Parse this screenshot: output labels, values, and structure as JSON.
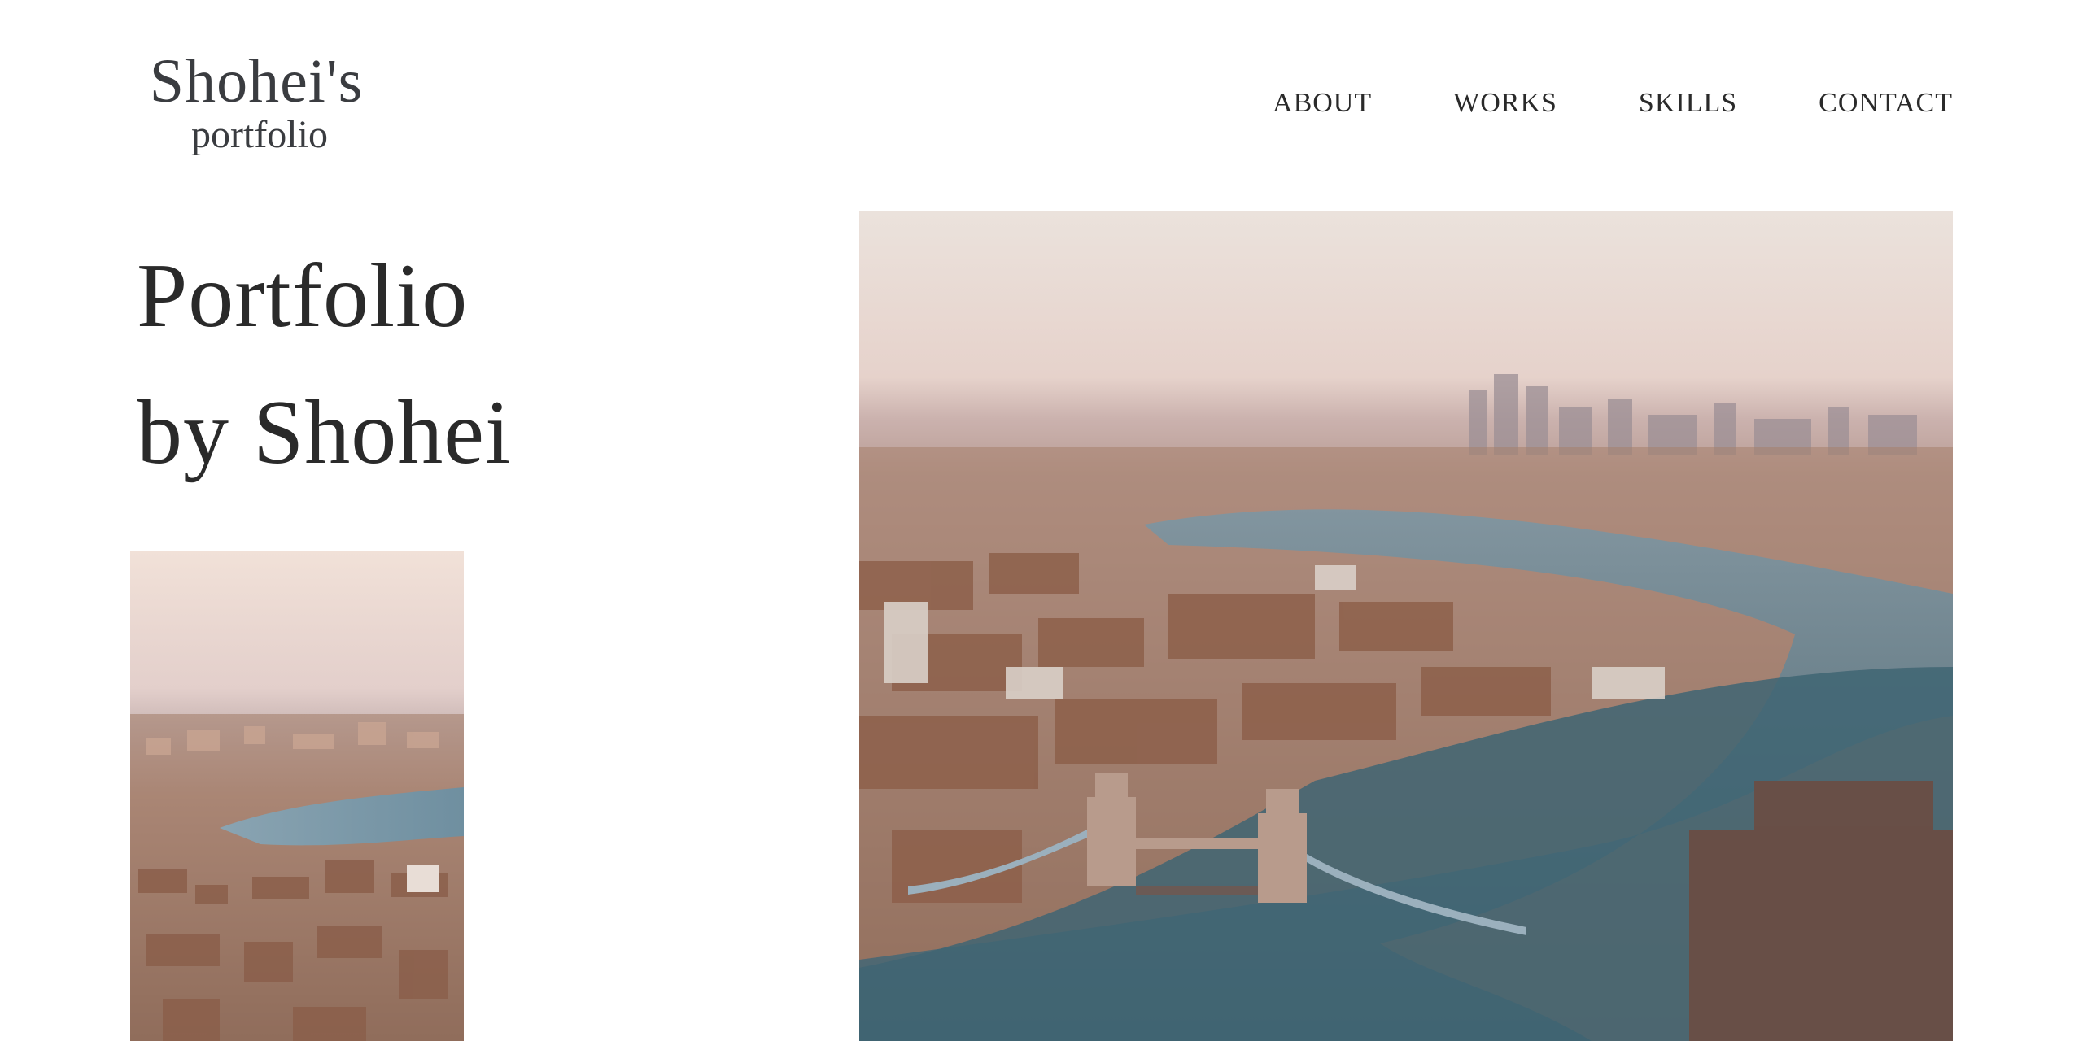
{
  "logo": {
    "main": "Shohei's",
    "sub": "portfolio"
  },
  "nav": {
    "items": [
      "ABOUT",
      "WORKS",
      "SKILLS",
      "CONTACT"
    ]
  },
  "hero": {
    "line1": "Portfolio",
    "line2": "by Shohei"
  },
  "images": {
    "small": {
      "subject": "aerial view of London river and city at dusk"
    },
    "large": {
      "subject": "aerial view of London with Tower Bridge and River Thames"
    }
  },
  "colors": {
    "text": "#2a2a2a",
    "background": "#ffffff",
    "sky": "#e9d6cf",
    "river": "#4d6b78"
  }
}
